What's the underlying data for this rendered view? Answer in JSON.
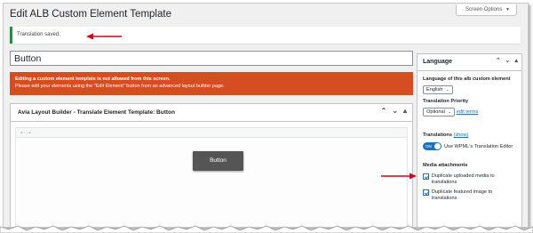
{
  "header": {
    "page_title": "Edit ALB Custom Element Template",
    "screen_options": "Screen Options"
  },
  "notice": {
    "text": "Translation saved."
  },
  "post": {
    "title_value": "Button"
  },
  "error": {
    "title": "Editing a custom element template is not allowed from this screen.",
    "body": "Please edit your elements using the \"Edit Element\" button from an advanced layout builder page."
  },
  "builder": {
    "title": "Avia Layout Builder - Translate Element Template: Button",
    "toolbar_icons": "⇠ ⇢",
    "element_label": "Button"
  },
  "sidebar": {
    "title": "Language",
    "language_label": "Language of this alb custom element",
    "language_value": "English",
    "priority_label": "Translation Priority",
    "priority_value": "Optional",
    "edit_terms": "edit terms",
    "translations_label": "Translations",
    "show_link": "(show)",
    "toggle_on": "ON",
    "toggle_text": "Use WPML's Translation Editor",
    "media_title": "Media attachments",
    "checkbox1": "Duplicate uploaded media to translations",
    "checkbox2": "Duplicate featured image to translations"
  },
  "colors": {
    "notice_border": "#00a32a",
    "error_bg": "#d54e21",
    "arrow": "#d0021b",
    "link": "#2271b1"
  }
}
